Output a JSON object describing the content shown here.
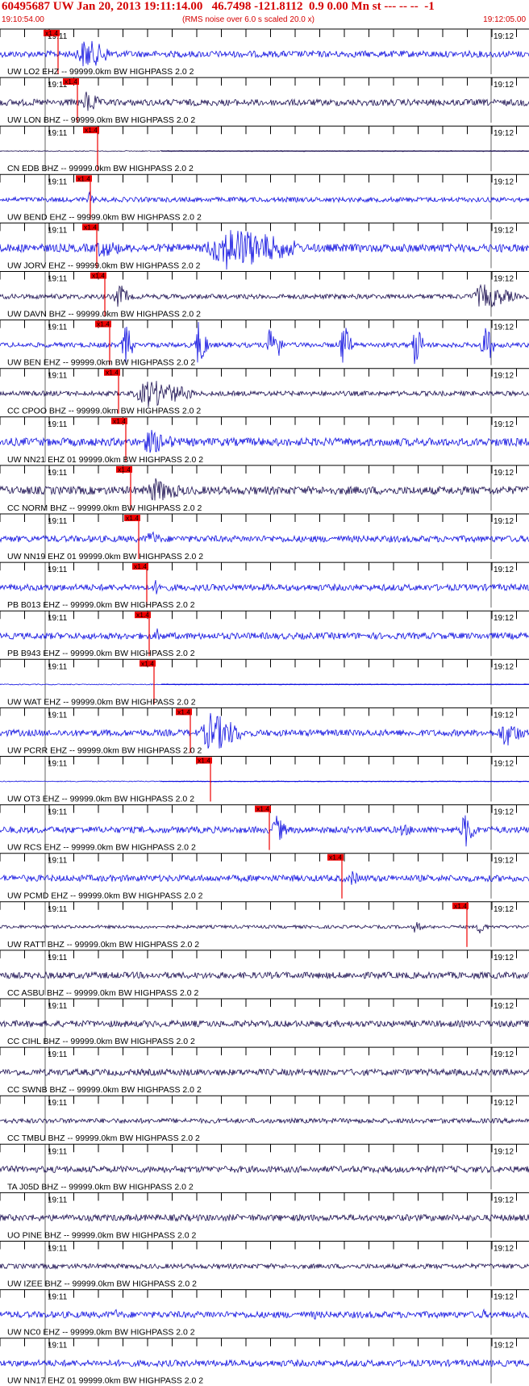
{
  "header": {
    "title": "60495687 UW Jan 20, 2013 19:11:14.00   46.7498 -121.8112  0.9 0.00 Mn st --- -- --  -1",
    "start_time": "19:10:54.00",
    "scale_note": "(RMS noise over 6.0 s scaled 20.0 x)",
    "end_time": "19:12:05.00"
  },
  "axis": {
    "left_tick_label": "19:11",
    "right_tick_label": "19:12"
  },
  "pick_label": "x1.4",
  "colors": {
    "header_text": "#d40000",
    "blue_trace": "#1010e0",
    "dark_trace": "#1c1052",
    "pick_fill": "#ee0000",
    "pick_line": "#ee0000",
    "scale_line": "#000000"
  },
  "panels": [
    {
      "label": "UW LO2 EHZ -- 99999.0km BW  HIGHPASS  2.0  2",
      "trace_color": "blue"
    },
    {
      "label": "UW LON BHZ -- 99999.0km BW  HIGHPASS  2.0  2",
      "trace_color": "dark"
    },
    {
      "label": "CN EDB BHZ -- 99999.0km BW  HIGHPASS  2.0  2",
      "trace_color": "dark"
    },
    {
      "label": "UW BEND EHZ -- 99999.0km BW  HIGHPASS  2.0  2",
      "trace_color": "blue"
    },
    {
      "label": "UW JORV EHZ -- 99999.0km BW  HIGHPASS  2.0  2",
      "trace_color": "blue"
    },
    {
      "label": "UW DAVN BHZ -- 99999.0km BW  HIGHPASS  2.0  2",
      "trace_color": "dark"
    },
    {
      "label": "UW BEN EHZ -- 99999.0km BW  HIGHPASS  2.0  2",
      "trace_color": "blue"
    },
    {
      "label": "CC CPOO BHZ -- 99999.0km BW  HIGHPASS  2.0  2",
      "trace_color": "dark"
    },
    {
      "label": "UW NN21 EHZ 01 99999.0km BW  HIGHPASS  2.0  2",
      "trace_color": "blue"
    },
    {
      "label": "CC NORM BHZ -- 99999.0km BW  HIGHPASS  2.0  2",
      "trace_color": "dark"
    },
    {
      "label": "UW NN19 EHZ 01 99999.0km BW  HIGHPASS  2.0  2",
      "trace_color": "blue"
    },
    {
      "label": "PB B013 EHZ -- 99999.0km BW  HIGHPASS  2.0  2",
      "trace_color": "blue"
    },
    {
      "label": "PB B943 EHZ -- 99999.0km BW  HIGHPASS  2.0  2",
      "trace_color": "blue"
    },
    {
      "label": "UW WAT EHZ -- 99999.0km BW  HIGHPASS  2.0  2",
      "trace_color": "blue"
    },
    {
      "label": "UW PCRR EHZ -- 99999.0km BW  HIGHPASS  2.0  2",
      "trace_color": "blue"
    },
    {
      "label": "UW OT3 EHZ -- 99999.0km BW  HIGHPASS  2.0  2",
      "trace_color": "blue"
    },
    {
      "label": "UW RCS EHZ -- 99999.0km BW  HIGHPASS  2.0  2",
      "trace_color": "blue"
    },
    {
      "label": "UW PCMD EHZ -- 99999.0km BW  HIGHPASS  2.0  2",
      "trace_color": "blue"
    },
    {
      "label": "UW RATT BHZ -- 99999.0km BW  HIGHPASS  2.0  2",
      "trace_color": "dark"
    },
    {
      "label": "CC ASBU BHZ -- 99999.0km BW  HIGHPASS  2.0  2",
      "trace_color": "dark"
    },
    {
      "label": "CC CIHL BHZ -- 99999.0km BW  HIGHPASS  2.0  2",
      "trace_color": "dark"
    },
    {
      "label": "CC SWNB BHZ -- 99999.0km BW  HIGHPASS  2.0  2",
      "trace_color": "dark"
    },
    {
      "label": "CC TMBU BHZ -- 99999.0km BW  HIGHPASS  2.0  2",
      "trace_color": "dark"
    },
    {
      "label": "TA J05D BHZ -- 99999.0km BW  HIGHPASS  2.0  2",
      "trace_color": "dark"
    },
    {
      "label": "UO PINE BHZ -- 99999.0km BW  HIGHPASS  2.0  2",
      "trace_color": "dark"
    },
    {
      "label": "UW IZEE BHZ -- 99999.0km BW  HIGHPASS  2.0  2",
      "trace_color": "dark"
    },
    {
      "label": "UW NC0 EHZ -- 99999.0km BW  HIGHPASS  2.0  2",
      "trace_color": "blue"
    },
    {
      "label": "UW NN17 EHZ 01 99999.0km BW  HIGHPASS  2.0  2",
      "trace_color": "blue"
    }
  ]
}
